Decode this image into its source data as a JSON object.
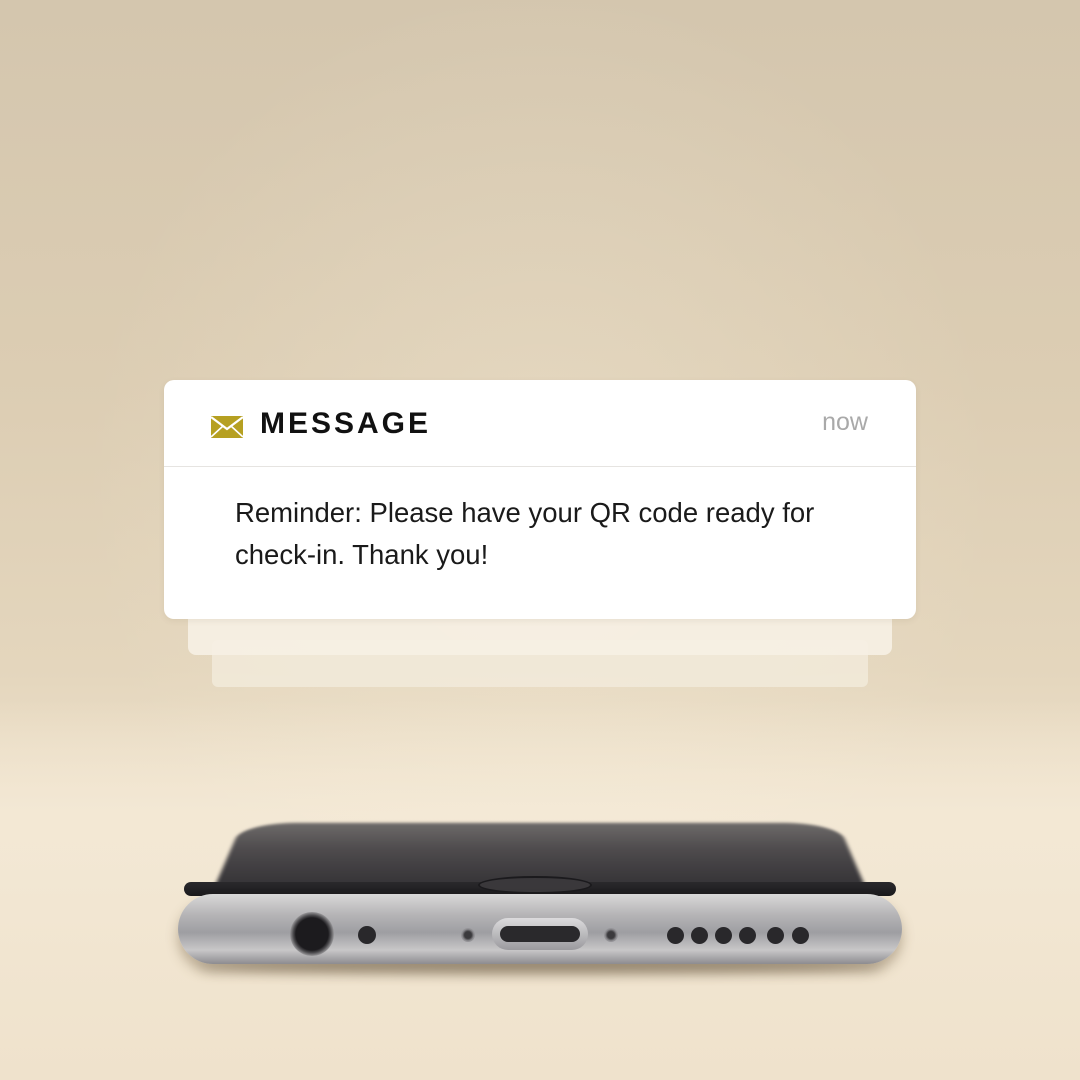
{
  "notification": {
    "app_name": "MESSAGE",
    "timestamp": "now",
    "body": "Reminder: Please have your QR code ready for check-in. Thank you!",
    "icon": "envelope-icon",
    "accent_color": "#b6a021"
  },
  "stack": {
    "hidden_notifications_visible": 2
  },
  "colors": {
    "background": "#d9cab0",
    "card": "#ffffff",
    "text": "#1a1a1a",
    "timestamp": "#a9a9a9"
  }
}
